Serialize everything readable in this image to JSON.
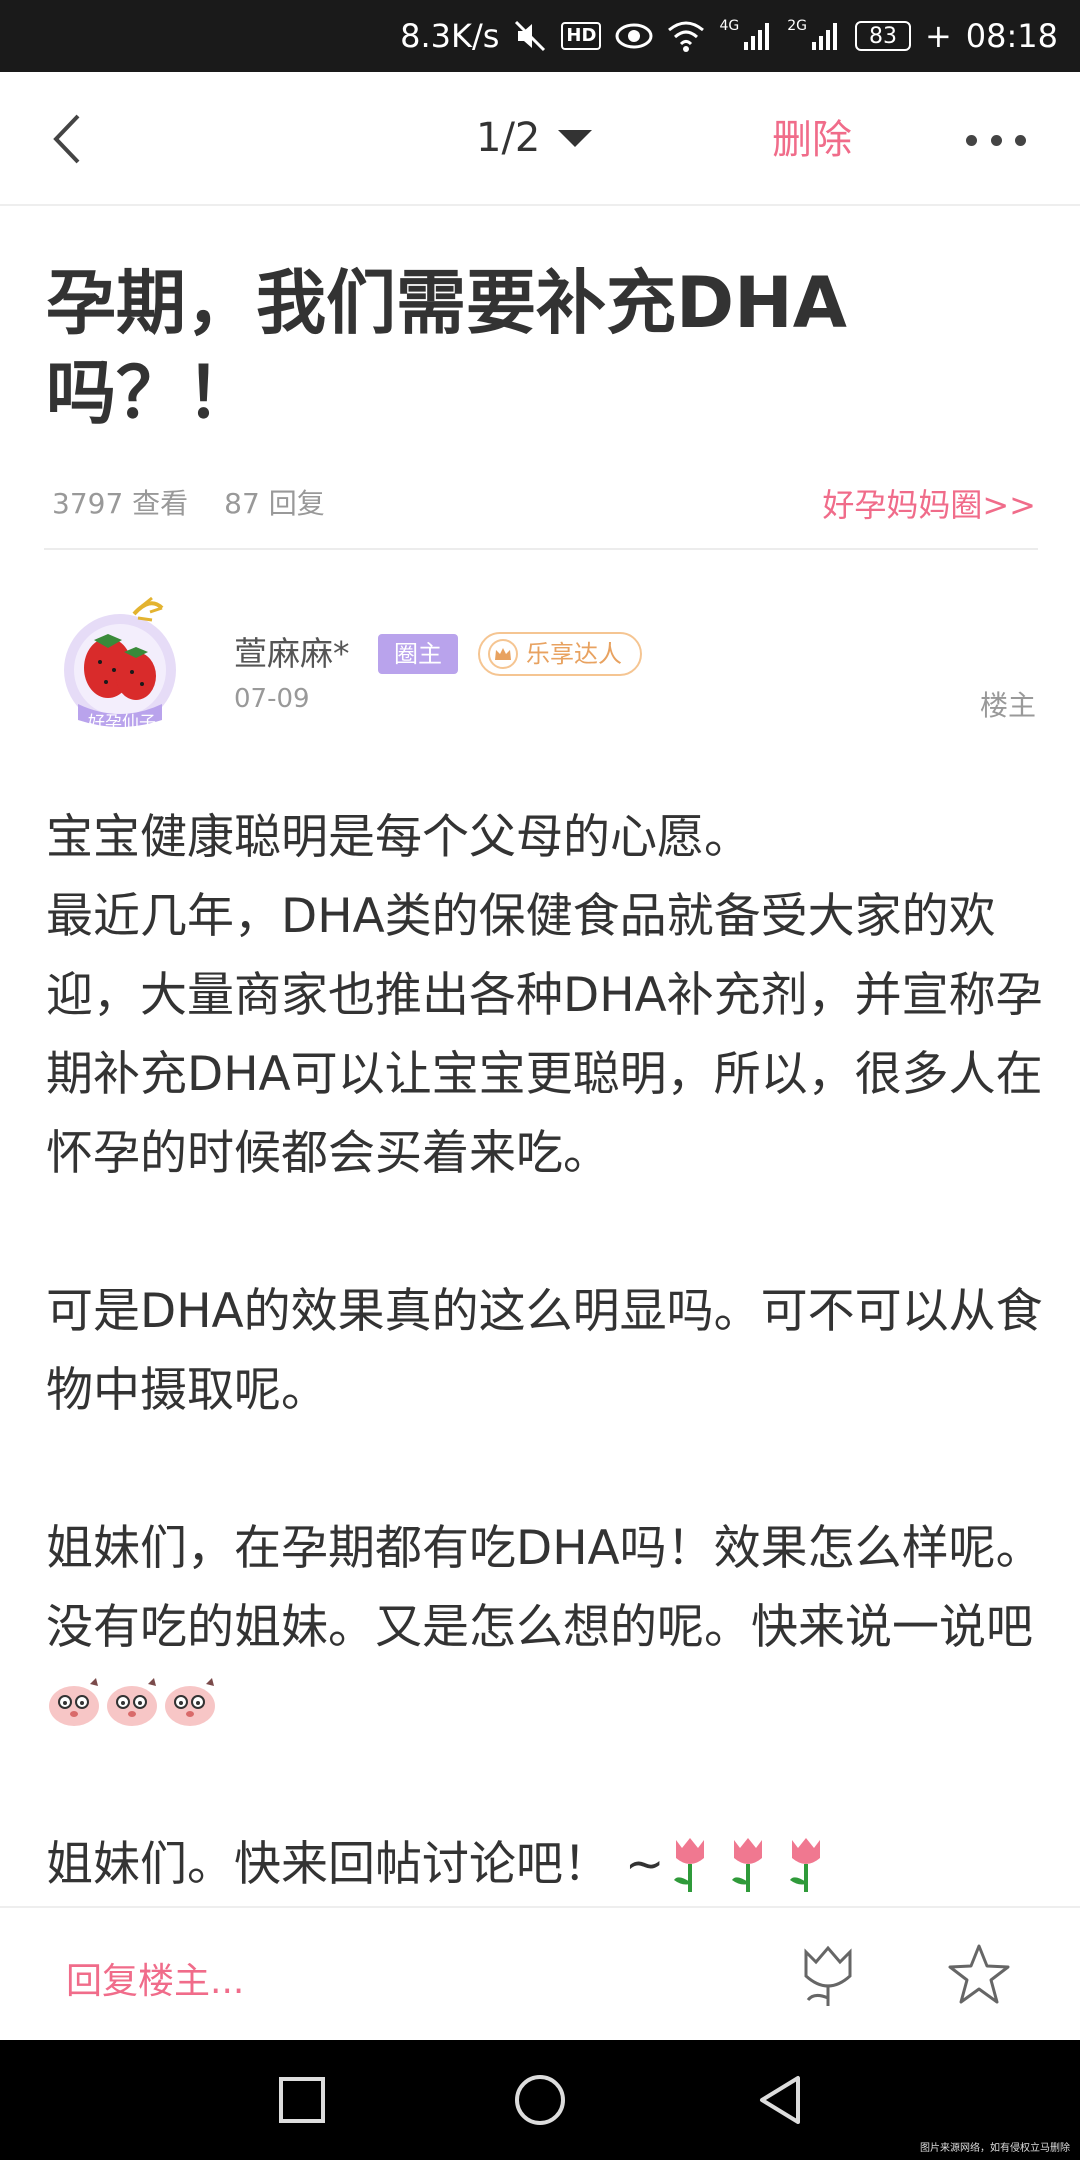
{
  "status_bar": {
    "speed": "8.3K/s",
    "hd": "HD",
    "net1": "4G",
    "net2": "2G",
    "battery": "83",
    "time": "08:18",
    "icons": [
      "mute-icon",
      "eye-icon",
      "wifi-icon",
      "signal-icon",
      "signal-icon",
      "charging-icon"
    ]
  },
  "nav": {
    "page": "1/2",
    "delete_label": "删除"
  },
  "post": {
    "title": "孕期，我们需要补充DHA吗？！",
    "views": "3797 查看",
    "replies": "87 回复",
    "circle_link": "好孕妈妈圈>>",
    "author": {
      "name": "萱麻麻*",
      "avatar_caption": "好孕仙子",
      "badge_owner": "圈主",
      "badge_talent": "乐享达人",
      "date": "07-09",
      "floor": "楼主"
    },
    "body": {
      "p1": "宝宝健康聪明是每个父母的心愿。\n最近几年，DHA类的保健食品就备受大家的欢迎，大量商家也推出各种DHA补充剂，并宣称孕期补充DHA可以让宝宝更聪明，所以，很多人在怀孕的时候都会买着来吃。",
      "p2": "可是DHA的效果真的这么明显吗。可不可以从食物中摄取呢。",
      "p3": "姐妹们，在孕期都有吃DHA吗！效果怎么样呢。没有吃的姐妹。又是怎么想的呢。快来说一说吧",
      "p4": "姐妹们。快来回帖讨论吧！ ~"
    }
  },
  "action_bar": {
    "reply_placeholder": "回复楼主..."
  },
  "watermark": "图片来源网络，如有侵权立马删除",
  "colors": {
    "accent": "#f06c8a",
    "owner_badge": "#b9a3ec",
    "talent_badge": "#e8a260"
  }
}
